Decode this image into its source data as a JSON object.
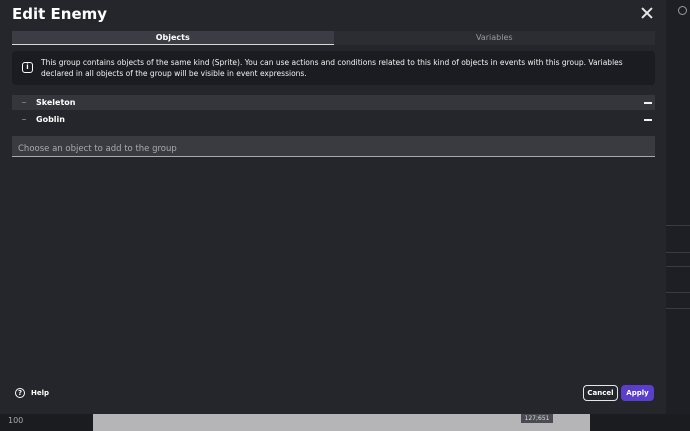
{
  "dialog": {
    "title": "Edit Enemy"
  },
  "tabs": [
    {
      "label": "Objects",
      "active": true
    },
    {
      "label": "Variables",
      "active": false
    }
  ],
  "info": {
    "text": "This group contains objects of the same kind (Sprite). You can use actions and conditions related to this kind of objects in events with this group. Variables declared in all objects of the group will be visible in event expressions."
  },
  "objects": [
    {
      "name": "Skeleton"
    },
    {
      "name": "Goblin"
    }
  ],
  "add_object": {
    "placeholder": "Choose an object to add to the group"
  },
  "footer": {
    "help_label": "Help",
    "cancel_label": "Cancel",
    "apply_label": "Apply"
  },
  "background": {
    "value_label": "100",
    "coords_label": "127;651"
  },
  "colors": {
    "accent": "#5b3ec9",
    "dialog_bg": "#25262c"
  }
}
